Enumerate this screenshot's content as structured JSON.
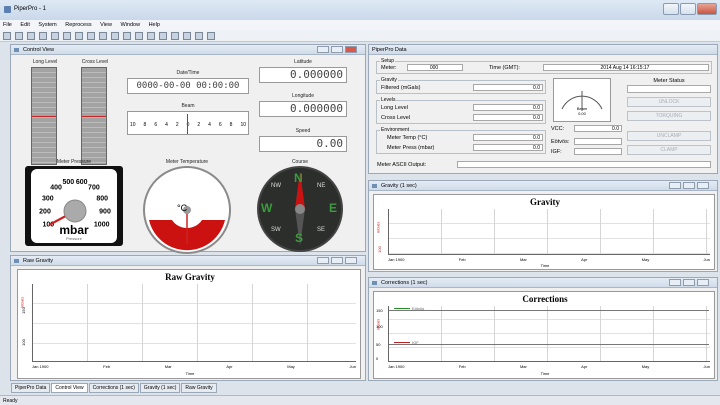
{
  "app": {
    "title": "PiperPro - 1",
    "status": "Ready"
  },
  "menu": [
    "File",
    "Edit",
    "System",
    "Reprocess",
    "View",
    "Window",
    "Help"
  ],
  "control_view": {
    "title": "Control View",
    "long_level_label": "Long Level",
    "cross_level_label": "Cross Level",
    "datetime_label": "Date/Time",
    "datetime_value": "0000-00-00 00:00:00",
    "beam_label": "Beam",
    "beam_ticks": [
      "10",
      "8",
      "6",
      "4",
      "2",
      "0",
      "2",
      "4",
      "6",
      "8",
      "10"
    ],
    "latitude_label": "Latitude",
    "latitude_value": "0.000000",
    "longitude_label": "Longitude",
    "longitude_value": "0.000000",
    "speed_label": "Speed",
    "speed_value": "0.00",
    "pressure_label": "Meter Pressure",
    "pressure_unit": "mbar",
    "pressure_sub": "Pressure",
    "pressure_ticks": [
      "100",
      "200",
      "300",
      "400",
      "500",
      "600",
      "700",
      "800",
      "900",
      "1000"
    ],
    "temperature_label": "Meter Temperature",
    "temperature_unit": "°C",
    "course_label": "Course",
    "compass": {
      "n": "N",
      "s": "S",
      "e": "E",
      "w": "W",
      "ne": "NE",
      "nw": "NW",
      "se": "SE",
      "sw": "SW"
    }
  },
  "piperpro_data": {
    "title": "PiperPro Data",
    "setup": {
      "label": "Setup",
      "meter_label": "Meter:",
      "meter_value": "000",
      "time_label": "Time (GMT):",
      "time_value": "2014 Aug 14 16:15:17"
    },
    "gravity": {
      "label": "Gravity",
      "filtered_label": "Filtered (mGals)",
      "filtered_value": "0.0"
    },
    "levels": {
      "label": "Levels",
      "long_label": "Long Level",
      "long_value": "0.0",
      "cross_label": "Cross Level",
      "cross_value": "0.0"
    },
    "environment": {
      "label": "Environment",
      "temp_label": "Meter Temp (°C)",
      "temp_value": "0.0",
      "press_label": "Meter Press (mbar)",
      "press_value": "0.0"
    },
    "beam_gauge": {
      "label": "Beam",
      "value": "0.00"
    },
    "vcc_label": "VCC:",
    "vcc_value": "0.0",
    "eotvos_label": "Eötvös:",
    "igf_label": "IGF:",
    "meter_status_label": "Meter Status",
    "status_buttons": [
      "UNLOCK",
      "TORQUING",
      "UNCLAMP",
      "CLAMP"
    ],
    "ascii_label": "Meter ASCII Output:"
  },
  "gravity_panel": {
    "title": "Gravity (1 sec)",
    "chart_title": "Gravity",
    "ylabel": "mGals",
    "ytick": "100",
    "xlabel": "Time",
    "xticks": [
      "Jan 1900",
      "Feb",
      "Mar",
      "Apr",
      "May",
      "Jun"
    ]
  },
  "raw_panel": {
    "title": "Raw Gravity",
    "chart_title": "Raw Gravity",
    "ylabel": "mGals",
    "yticks": [
      "150",
      "100"
    ],
    "xlabel": "Time",
    "xticks": [
      "Jan 1900",
      "Feb",
      "Mar",
      "Apr",
      "May",
      "Jun"
    ]
  },
  "corr_panel": {
    "title": "Corrections (1 sec)",
    "chart_title": "Corrections",
    "eotvos_legend": "Eötvös",
    "igf_legend": "IGF",
    "ylabel": "mGals",
    "yticks": [
      "150",
      "100",
      "50",
      "0"
    ],
    "xlabel": "Time",
    "xticks": [
      "Jan 1900",
      "Feb",
      "Mar",
      "Apr",
      "May",
      "Jun"
    ]
  },
  "tabs": [
    "PiperPro Data",
    "Control View",
    "Corrections (1 sec)",
    "Gravity (1 sec)",
    "Raw Gravity"
  ],
  "active_tab": "Control View"
}
